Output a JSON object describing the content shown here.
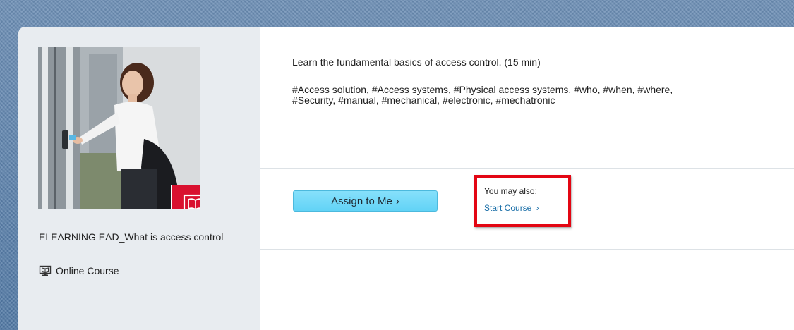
{
  "course": {
    "title": "ELEARNING EAD_What is access control",
    "type_label": "Online Course",
    "type_icon": "monitor-book-icon",
    "badge_icon": "monitor-book-icon",
    "description": "Learn the fundamental basics of access control. (15 min)",
    "tags_line1": "#Access solution, #Access systems, #Physical access systems, #who, #when, #where,",
    "tags_line2": "#Security, #manual, #mechanical, #electronic, #mechatronic"
  },
  "actions": {
    "assign_label": "Assign to Me",
    "assign_chevron": "›",
    "also_label": "You may also:",
    "start_label": "Start Course",
    "start_chevron": "›"
  },
  "colors": {
    "badge": "#d9102f",
    "button": "#6fd8f8",
    "link": "#1a6fa8",
    "highlight": "#e30613"
  }
}
